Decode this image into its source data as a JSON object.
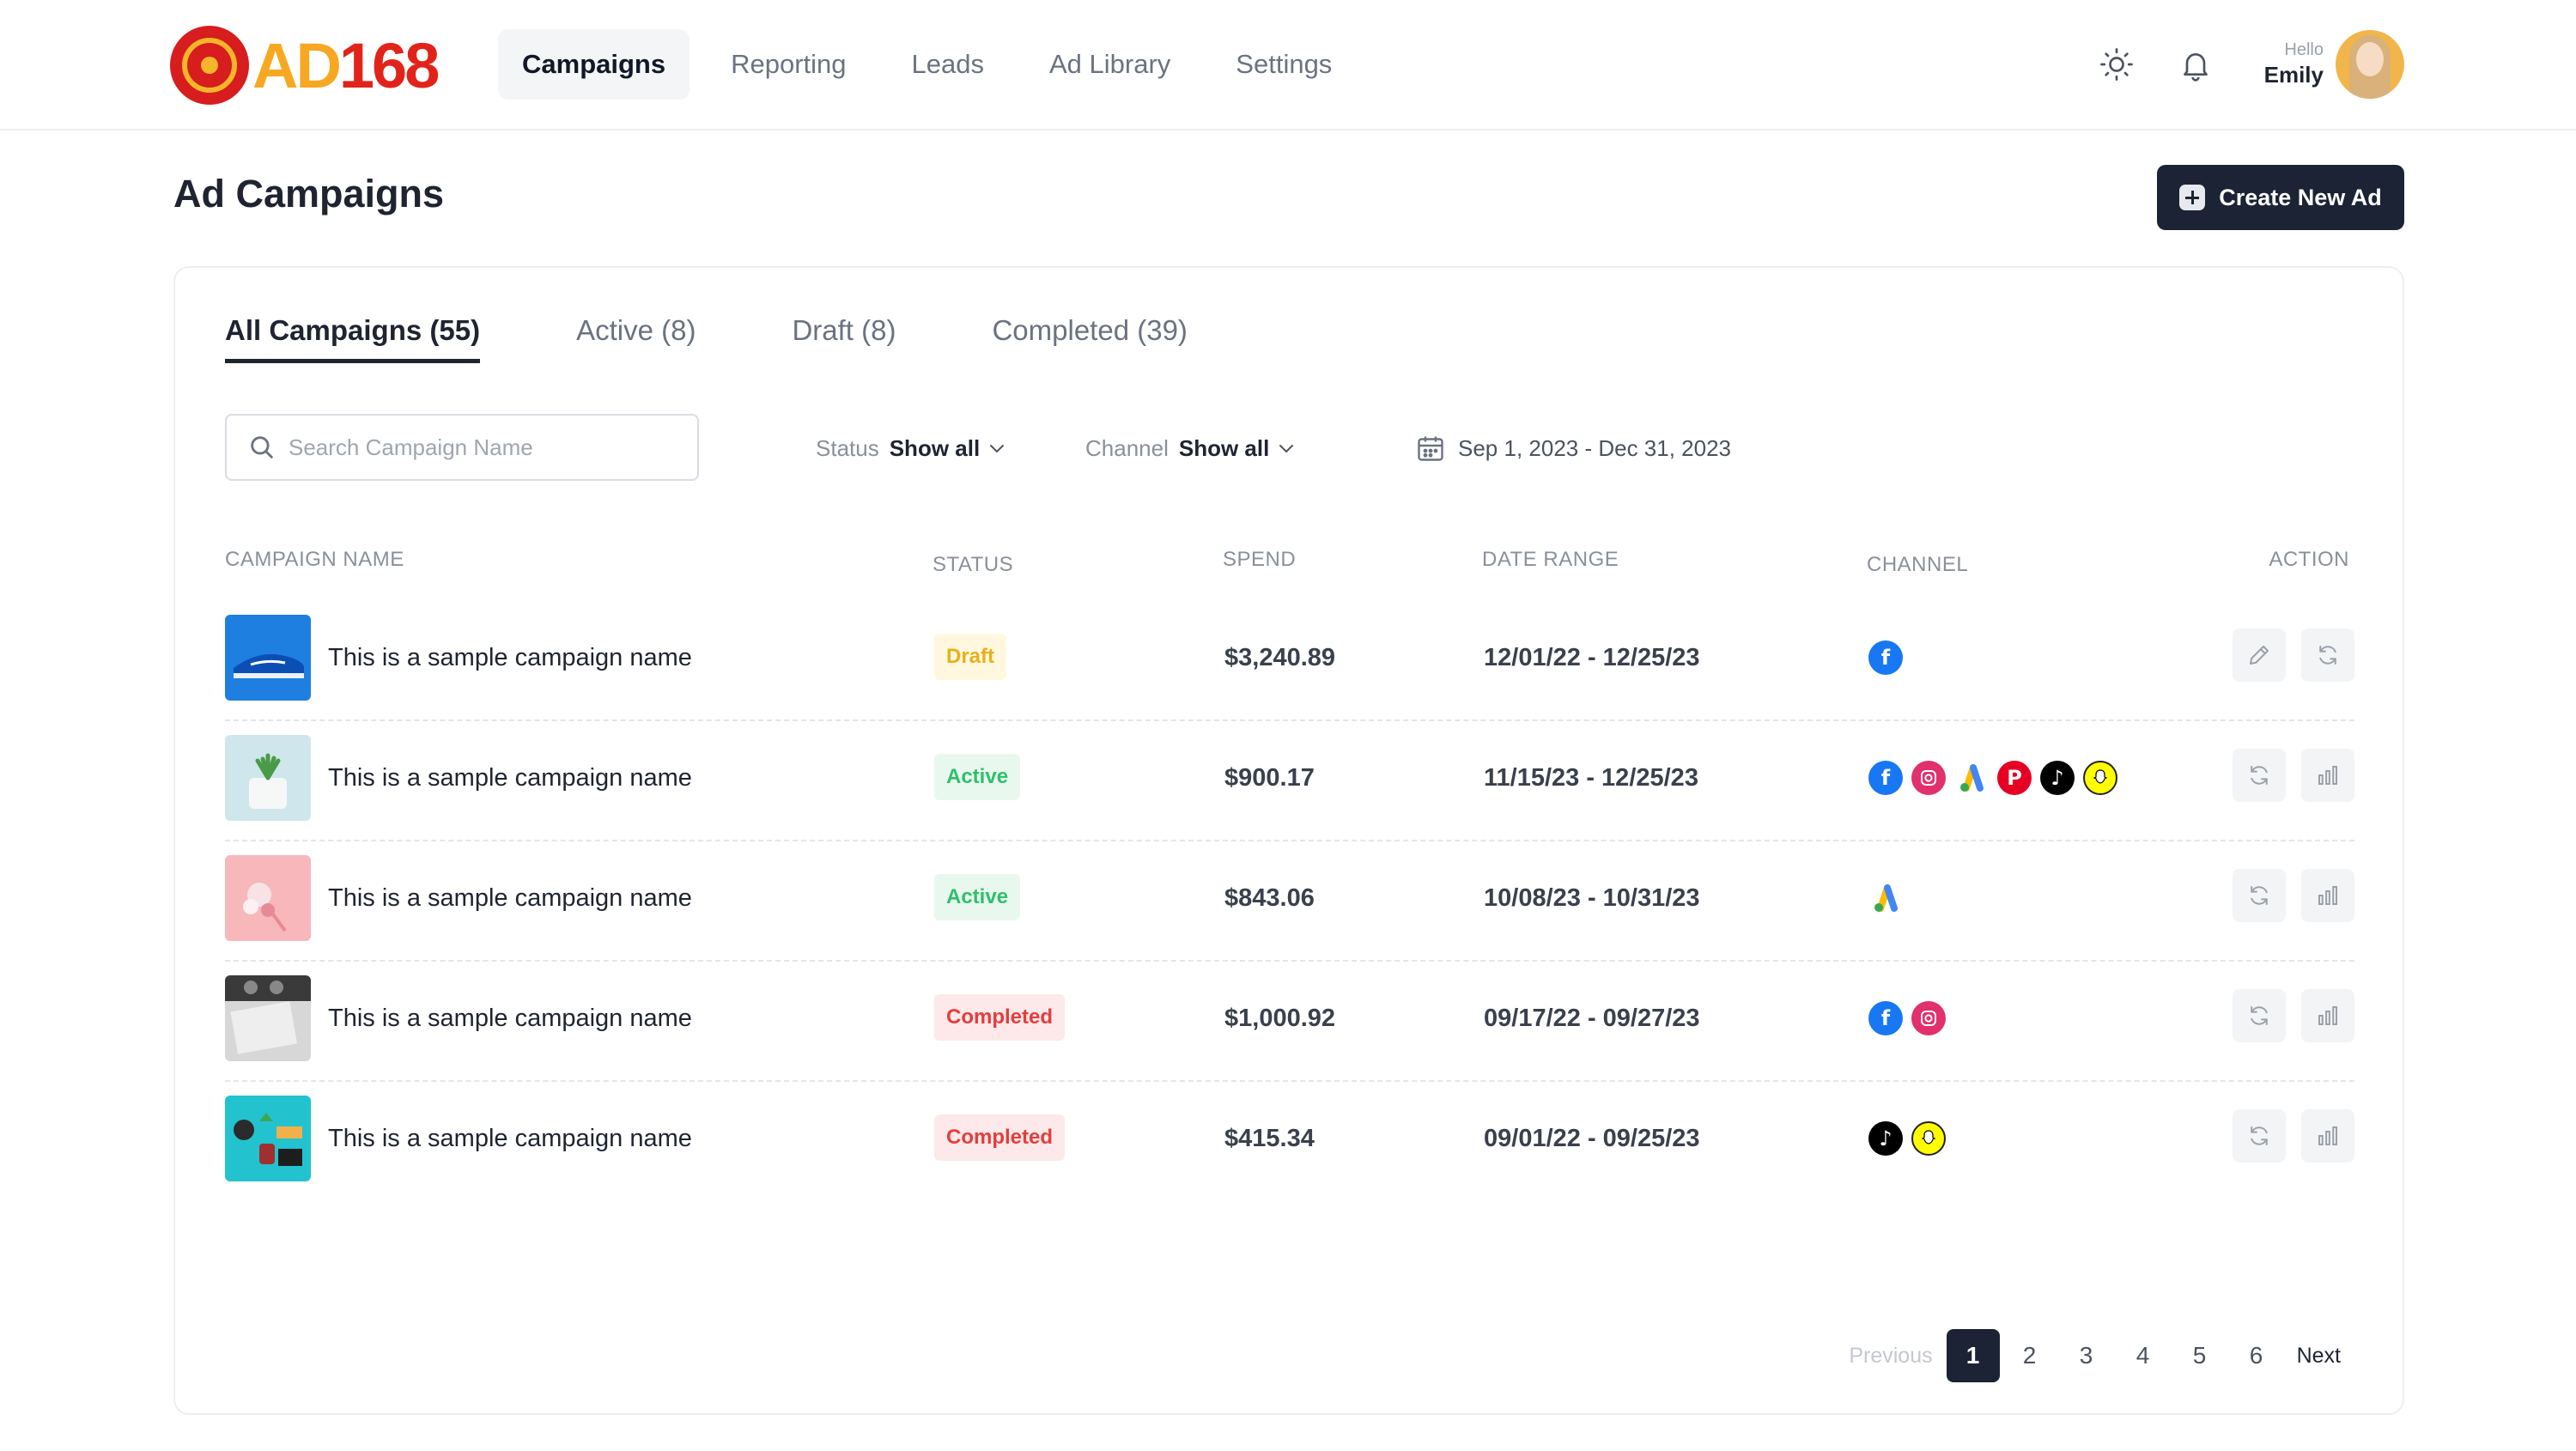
{
  "brand": {
    "name": "AD168",
    "prefix": "AD",
    "suffix": "168"
  },
  "nav": {
    "items": [
      {
        "label": "Campaigns",
        "active": true
      },
      {
        "label": "Reporting",
        "active": false
      },
      {
        "label": "Leads",
        "active": false
      },
      {
        "label": "Ad Library",
        "active": false
      },
      {
        "label": "Settings",
        "active": false
      }
    ]
  },
  "user": {
    "greeting": "Hello",
    "name": "Emily"
  },
  "page": {
    "title": "Ad Campaigns",
    "create_label": "Create New Ad"
  },
  "tabs": [
    {
      "label": "All Campaigns (55)",
      "active": true
    },
    {
      "label": "Active (8)",
      "active": false
    },
    {
      "label": "Draft (8)",
      "active": false
    },
    {
      "label": "Completed (39)",
      "active": false
    }
  ],
  "search": {
    "placeholder": "Search Campaign Name",
    "value": ""
  },
  "filters": {
    "status": {
      "label": "Status",
      "value": "Show all"
    },
    "channel": {
      "label": "Channel",
      "value": "Show all"
    },
    "date_range": "Sep 1, 2023 - Dec 31, 2023"
  },
  "table": {
    "columns": [
      "CAMPAIGN NAME",
      "STATUS",
      "SPEND",
      "DATE RANGE",
      "CHANNEL",
      "ACTION"
    ],
    "rows": [
      {
        "name": "This is a sample campaign name",
        "status": "Draft",
        "spend": "$3,240.89",
        "date_range": "12/01/22 - 12/25/23",
        "channels": [
          "facebook"
        ],
        "actions": [
          "edit",
          "refresh"
        ]
      },
      {
        "name": "This is a sample campaign name",
        "status": "Active",
        "spend": "$900.17",
        "date_range": "11/15/23 - 12/25/23",
        "channels": [
          "facebook",
          "instagram",
          "google-ads",
          "pinterest",
          "tiktok",
          "snapchat"
        ],
        "actions": [
          "refresh",
          "analytics"
        ]
      },
      {
        "name": "This is a sample campaign name",
        "status": "Active",
        "spend": "$843.06",
        "date_range": "10/08/23 - 10/31/23",
        "channels": [
          "google-ads"
        ],
        "actions": [
          "refresh",
          "analytics"
        ]
      },
      {
        "name": "This is a sample campaign name",
        "status": "Completed",
        "spend": "$1,000.92",
        "date_range": "09/17/22 - 09/27/23",
        "channels": [
          "facebook",
          "instagram"
        ],
        "actions": [
          "refresh",
          "analytics"
        ]
      },
      {
        "name": "This is a sample campaign name",
        "status": "Completed",
        "spend": "$415.34",
        "date_range": "09/01/22 - 09/25/23",
        "channels": [
          "tiktok",
          "snapchat"
        ],
        "actions": [
          "refresh",
          "analytics"
        ]
      }
    ]
  },
  "pagination": {
    "previous": "Previous",
    "next": "Next",
    "pages": [
      "1",
      "2",
      "3",
      "4",
      "5",
      "6"
    ],
    "current": "1"
  },
  "colors": {
    "primary": "#1b2334",
    "draft": "#e8b018",
    "active": "#2fbf6b",
    "completed": "#e43d3d"
  }
}
